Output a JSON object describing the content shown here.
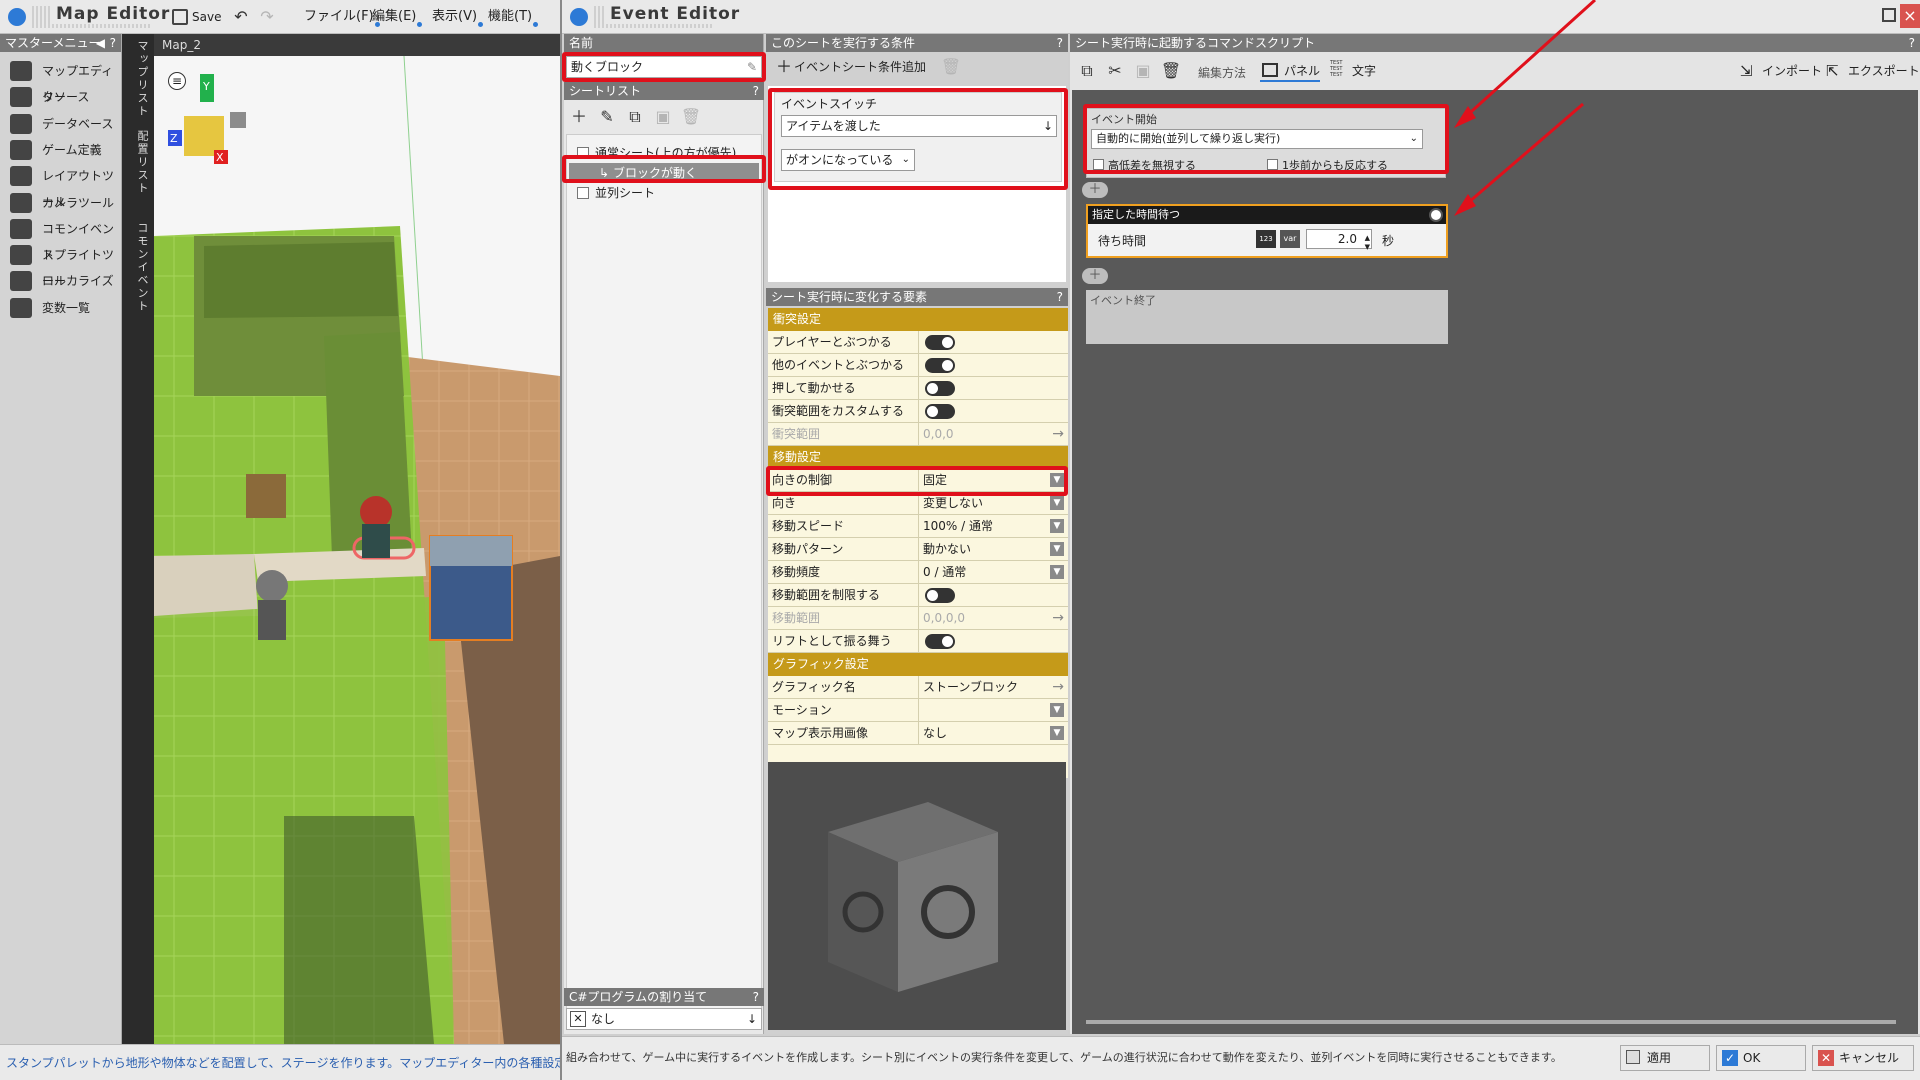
{
  "map_editor": {
    "title": "Map Editor",
    "save_label": "Save",
    "menus": [
      "ファイル(F)",
      "編集(E)",
      "表示(V)",
      "機能(T)"
    ],
    "sidebar": {
      "header": "マスターメニュー",
      "help": "?",
      "collapse": "◀",
      "items": [
        {
          "label": "マップエディター",
          "icon": "map-icon"
        },
        {
          "label": "リソース",
          "icon": "resource-icon"
        },
        {
          "label": "データベース",
          "icon": "database-icon"
        },
        {
          "label": "ゲーム定義",
          "icon": "game-definition-icon"
        },
        {
          "label": "レイアウトツール",
          "icon": "layout-icon"
        },
        {
          "label": "カメラツール",
          "icon": "camera-icon"
        },
        {
          "label": "コモンイベント",
          "icon": "common-event-icon"
        },
        {
          "label": "スプライトツール",
          "icon": "sprite-icon"
        },
        {
          "label": "ローカライズ",
          "icon": "localize-icon"
        },
        {
          "label": "変数一覧",
          "icon": "variables-icon"
        }
      ]
    },
    "vertical_tabs": [
      "マップリスト",
      "配置リスト",
      "コモンイベント"
    ],
    "viewport_tab": "Map_2",
    "gizmo_axes": {
      "x": "X",
      "y": "Y",
      "z": "Z"
    },
    "status": "スタンプパレットから地形や物体などを配置して、ステージを作ります。マップエディター内の各種設定は画面右"
  },
  "event_editor": {
    "title": "Event Editor",
    "name_header": "名前",
    "name_value": "動くブロック",
    "sheet_list_header": "シートリスト",
    "help": "?",
    "sheets": [
      {
        "label": "通常シート(上の方が優先)",
        "indent": 0
      },
      {
        "label": "ブロックが動く",
        "indent": 1
      },
      {
        "label": "並列シート",
        "indent": 0
      }
    ],
    "csharp_header": "C#プログラムの割り当て",
    "csharp_value": "なし",
    "conditions_header": "このシートを実行する条件",
    "add_condition_label": "イベントシート条件追加",
    "event_switch_label": "イベントスイッチ",
    "switch_value": "アイテムを渡した",
    "switch_state": "がオンになっている",
    "elements_header": "シート実行時に変化する要素",
    "collision_section": "衝突設定",
    "collision_rows": [
      {
        "label": "プレイヤーとぶつかる",
        "toggle": "on",
        "disabled": false
      },
      {
        "label": "他のイベントとぶつかる",
        "toggle": "on",
        "disabled": false
      },
      {
        "label": "押して動かせる",
        "toggle": "off",
        "disabled": false
      },
      {
        "label": "衝突範囲をカスタムする",
        "toggle": "off",
        "disabled": false
      },
      {
        "label": "衝突範囲",
        "value": "0,0,0",
        "disabled": true
      }
    ],
    "movement_section": "移動設定",
    "movement_rows": [
      {
        "label": "向きの制御",
        "value": "固定",
        "disabled": false
      },
      {
        "label": "向き",
        "value": "変更しない",
        "disabled": false
      },
      {
        "label": "移動スピード",
        "value": "100% / 通常",
        "disabled": false
      },
      {
        "label": "移動パターン",
        "value": "動かない",
        "disabled": false
      },
      {
        "label": "移動頻度",
        "value": "0 / 通常",
        "disabled": false
      },
      {
        "label": "移動範囲を制限する",
        "toggle": "off",
        "disabled": false
      },
      {
        "label": "移動範囲",
        "value": "0,0,0,0",
        "disabled": true
      },
      {
        "label": "リフトとして振る舞う",
        "toggle": "on",
        "disabled": false
      }
    ],
    "graphics_section": "グラフィック設定",
    "graphics_rows": [
      {
        "label": "グラフィック名",
        "value": "ストーンブロック"
      },
      {
        "label": "モーション",
        "value": ""
      },
      {
        "label": "マップ表示用画像",
        "value": "なし"
      }
    ],
    "script_header": "シート実行時に起動するコマンドスクリプト",
    "toolbar": {
      "edit_method": "編集方法",
      "panel": "パネル",
      "text": "文字",
      "test_glyph": "TEST\nTEST\nTEST",
      "import": "インポート",
      "export": "エクスポート"
    },
    "script": {
      "start_title": "イベント開始",
      "start_mode": "自動的に開始(並列して繰り返し実行)",
      "ignore_height": "高低差を無視する",
      "one_step": "1歩前からも反応する",
      "wait_title": "指定した時間待つ",
      "wait_label": "待ち時間",
      "num_badge": "123",
      "var_badge": "var",
      "wait_value": "2.0",
      "wait_unit": "秒",
      "end_label": "イベント終了"
    },
    "status": "組み合わせて、ゲーム中に実行するイベントを作成します。シート別にイベントの実行条件を変更して、ゲームの進行状況に合わせて動作を変えたり、並列イベントを同時に実行させることもできます。",
    "apply_label": "適用",
    "ok_label": "OK",
    "cancel_label": "キャンセル"
  },
  "colors": {
    "highlight": "#e0101b",
    "section": "#c59a19",
    "accent": "#2d7ad6"
  }
}
